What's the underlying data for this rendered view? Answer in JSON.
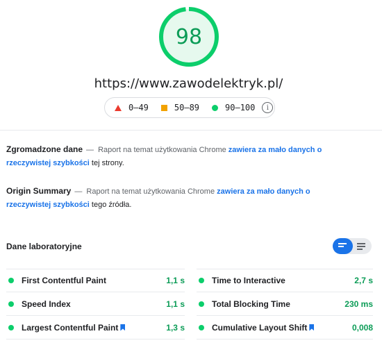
{
  "score": {
    "value": "98",
    "fraction": 0.98,
    "color": "#0cce6b"
  },
  "url": "https://www.zawodelektryk.pl/",
  "legend": {
    "fail": "0–49",
    "average": "50–89",
    "pass": "90–100",
    "info_icon": "info-icon"
  },
  "field_data": {
    "title": "Zgromadzone dane",
    "separator": "—",
    "prefix": "Raport na temat użytkowania Chrome",
    "link": "zawiera za mało danych o rzeczywistej szybkości",
    "suffix": "tej strony."
  },
  "origin_summary": {
    "title": "Origin Summary",
    "separator": "—",
    "prefix": "Raport na temat użytkowania Chrome",
    "link": "zawiera za mało danych o rzeczywistej szybkości",
    "suffix": "tego źródła."
  },
  "lab": {
    "title": "Dane laboratoryjne",
    "metrics_left": [
      {
        "name": "First Contentful Paint",
        "value": "1,1 s"
      },
      {
        "name": "Speed Index",
        "value": "1,1 s"
      },
      {
        "name": "Largest Contentful Paint",
        "value": "1,3 s"
      }
    ],
    "metrics_right": [
      {
        "name": "Time to Interactive",
        "value": "2,7 s"
      },
      {
        "name": "Total Blocking Time",
        "value": "230 ms"
      },
      {
        "name": "Cumulative Layout Shift",
        "value": "0,008"
      }
    ]
  },
  "colors": {
    "pass": "#0cce6b",
    "average": "#f2a200",
    "fail": "#eb3a2e",
    "link": "#1a73e8"
  }
}
